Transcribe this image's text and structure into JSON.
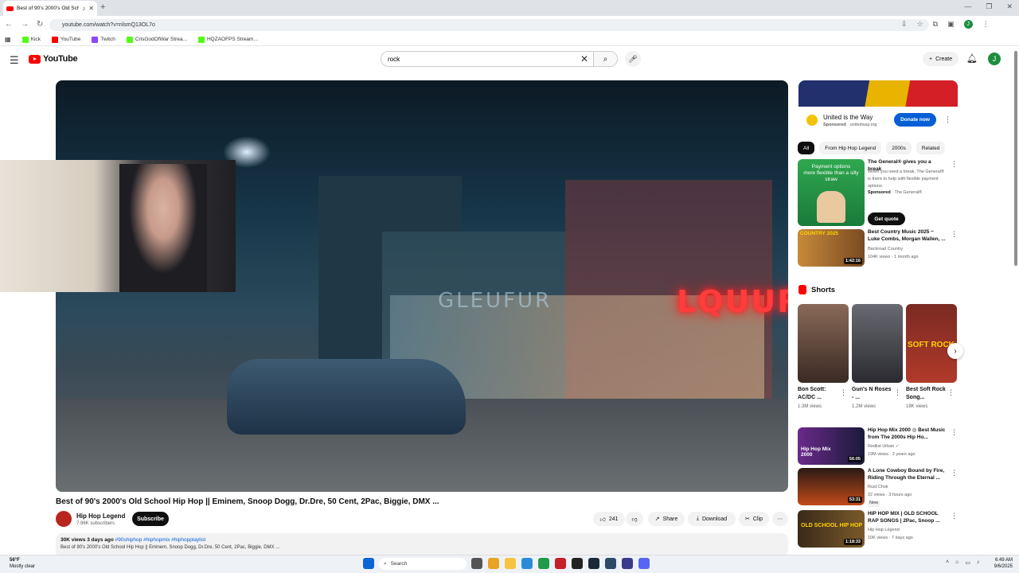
{
  "browser": {
    "tab_title": "Best of 90's 2000's Old Sch",
    "new_tab": "+",
    "url": "youtube.com/watch?v=nlsmQ13OL7o",
    "bookmarks": [
      "Kick",
      "YouTube",
      "Twitch",
      "CrisGodOfWar Strea...",
      "HQZAOFPS Stream..."
    ],
    "profile_initial": "J"
  },
  "header": {
    "logo_text": "YouTube",
    "search_value": "rock",
    "create_label": "Create",
    "avatar_initial": "J"
  },
  "player": {
    "neon_sign": "LQUUR",
    "neon_sign_2": "GLEUFUR"
  },
  "video": {
    "title": "Best of 90's 2000's Old School Hip Hop || Eminem, Snoop Dogg, Dr.Dre, 50 Cent, 2Pac, Biggie, DMX ...",
    "channel_name": "Hip Hop Legend",
    "subscribers": "7.96K subscribers",
    "subscribe_label": "Subscribe",
    "likes": "241",
    "share_label": "Share",
    "download_label": "Download",
    "clip_label": "Clip",
    "desc_meta": "30K views  3 days ago",
    "desc_tags": "#90shiphop #hiphopmix #hiphopplaylist",
    "desc_text": "Best of 90's 2000's Old School Hip Hop || Eminem, Snoop Dogg, Dr.Dre, 50 Cent, 2Pac, Biggie, DMX ..."
  },
  "sidebar": {
    "ad": {
      "title": "United is the Way",
      "sponsored": "Sponsored",
      "domain": "· unitedway.org",
      "cta": "Donate now"
    },
    "chips": [
      "All",
      "From Hip Hop Legend",
      "2000s",
      "Related"
    ],
    "promo": {
      "thumb_text_1": "Payment options",
      "thumb_text_2": "more flexible than a silly straw",
      "title": "The General® gives you a break",
      "desc": "When you need a break, The General® is there to help with flexible payment options.",
      "sponsored": "Sponsored",
      "advertiser": "· The General®",
      "cta": "Get quote"
    },
    "videos": [
      {
        "title": "Best Country Music 2025 ~ Luke Combs, Morgan Wallen, ...",
        "channel": "Backroad Country",
        "meta": "104K views · 1 month ago",
        "duration": "1:42:16",
        "thumb_label": "COUNTRY 2025"
      },
      {
        "title": "Hip Hop Mix 2000 ◎ Best Music from The 2000s Hip Ho...",
        "channel": "Redlist Urban ✓",
        "meta": "19M views · 2 years ago",
        "duration": "56:05",
        "thumb_label": "Hip Hop Mix 2000"
      },
      {
        "title": "A Lone Cowboy Bound by Fire, Riding Through the Eternal ...",
        "channel": "Rust Choir",
        "meta": "22 views · 3 hours ago",
        "badge": "New",
        "duration": "53:31"
      },
      {
        "title": "HIP HOP MIX | OLD SCHOOL RAP SONGS | 2Pac, Snoop ...",
        "channel": "Hip Hop Legend",
        "meta": "10K views · 7 days ago",
        "duration": "1:18:33",
        "thumb_label": "OLD SCHOOL HIP HOP"
      }
    ],
    "shorts_heading": "Shorts",
    "shorts": [
      {
        "title": "Bon Scott: AC/DC ...",
        "views": "1.3M views"
      },
      {
        "title": "Gun's N Roses - ...",
        "views": "1.2M views"
      },
      {
        "title": "Best Soft Rock Song...",
        "views": "18K views",
        "thumb_label": "SOFT ROCK"
      }
    ]
  },
  "taskbar": {
    "temp": "56°F",
    "weather": "Mostly clear",
    "search_label": "Search",
    "time": "6:49 AM",
    "date": "9/6/2025"
  },
  "colors": {
    "brand_red": "#ff0000",
    "link_blue": "#065fd4",
    "neon_red": "#ff3b3b"
  }
}
